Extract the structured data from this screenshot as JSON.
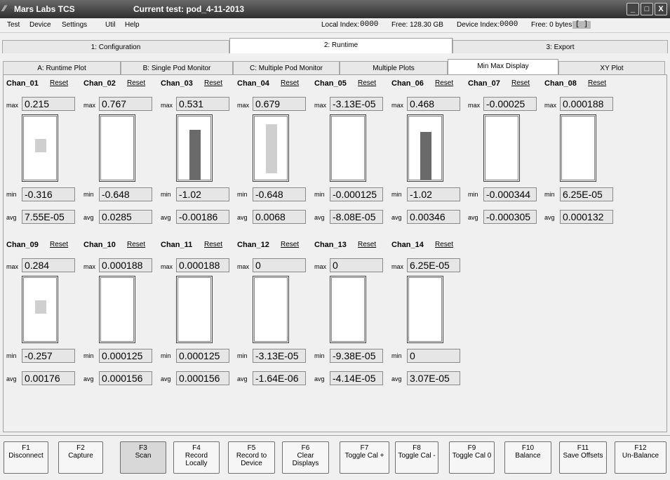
{
  "window": {
    "app_title": "Mars Labs TCS",
    "current_test": "Current test: pod_4-11-2013",
    "controls": [
      "_",
      "□",
      "X"
    ]
  },
  "menu": {
    "items": [
      "Test",
      "Device",
      "Settings",
      "Util",
      "Help"
    ]
  },
  "status": {
    "local_index_label": "Local Index:",
    "local_index_value": "0000",
    "local_free": "Free: 128.30 GB",
    "device_index_label": "Device Index:",
    "device_index_value": "0000",
    "device_free": "Free: 0 bytes",
    "indicator": "[ ]"
  },
  "main_tabs": [
    "1: Configuration",
    "2: Runtime",
    "3: Export"
  ],
  "sub_tabs": [
    "A: Runtime Plot",
    "B: Single Pod Monitor",
    "C: Multiple Pod Monitor",
    "Multiple Plots",
    "Min Max Display",
    "XY Plot"
  ],
  "labels": {
    "max": "max",
    "min": "min",
    "avg": "avg",
    "reset": "Reset"
  },
  "channels": [
    {
      "name": "Chan_01",
      "max": "0.215",
      "min": "-0.316",
      "avg": "7.55E-05",
      "bar": {
        "from": 0.42,
        "to": 0.63,
        "style": "light"
      }
    },
    {
      "name": "Chan_02",
      "max": "0.767",
      "min": "-0.648",
      "avg": "0.0285",
      "bar": null
    },
    {
      "name": "Chan_03",
      "max": "0.531",
      "min": "-1.02",
      "avg": "-0.00186",
      "bar": {
        "from": 0.0,
        "to": 0.77,
        "style": "dark"
      }
    },
    {
      "name": "Chan_04",
      "max": "0.679",
      "min": "-0.648",
      "avg": "0.0068",
      "bar": {
        "from": 0.1,
        "to": 0.86,
        "style": "light"
      }
    },
    {
      "name": "Chan_05",
      "max": "-3.13E-05",
      "min": "-0.000125",
      "avg": "-8.08E-05",
      "bar": null
    },
    {
      "name": "Chan_06",
      "max": "0.468",
      "min": "-1.02",
      "avg": "0.00346",
      "bar": {
        "from": 0.0,
        "to": 0.74,
        "style": "dark"
      }
    },
    {
      "name": "Chan_07",
      "max": "-0.00025",
      "min": "-0.000344",
      "avg": "-0.000305",
      "bar": null
    },
    {
      "name": "Chan_08",
      "max": "0.000188",
      "min": "6.25E-05",
      "avg": "0.000132",
      "bar": null
    },
    {
      "name": "Chan_09",
      "max": "0.284",
      "min": "-0.257",
      "avg": "0.00176",
      "bar": {
        "from": 0.42,
        "to": 0.63,
        "style": "light"
      }
    },
    {
      "name": "Chan_10",
      "max": "0.000188",
      "min": "0.000125",
      "avg": "0.000156",
      "bar": null
    },
    {
      "name": "Chan_11",
      "max": "0.000188",
      "min": "0.000125",
      "avg": "0.000156",
      "bar": null
    },
    {
      "name": "Chan_12",
      "max": "0",
      "min": "-3.13E-05",
      "avg": "-1.64E-06",
      "bar": null
    },
    {
      "name": "Chan_13",
      "max": "0",
      "min": "-9.38E-05",
      "avg": "-4.14E-05",
      "bar": null
    },
    {
      "name": "Chan_14",
      "max": "6.25E-05",
      "min": "0",
      "avg": "3.07E-05",
      "bar": null
    }
  ],
  "function_keys": [
    {
      "key": "F1",
      "label": "Disconnect",
      "pressed": false
    },
    {
      "key": "F2",
      "label": "Capture",
      "pressed": false
    },
    {
      "key": "F3",
      "label": "Scan",
      "pressed": true
    },
    {
      "key": "F4",
      "label": "Record\nLocally",
      "pressed": false
    },
    {
      "key": "F5",
      "label": "Record to\nDevice",
      "pressed": false
    },
    {
      "key": "F6",
      "label": "Clear\nDisplays",
      "pressed": false
    },
    {
      "key": "F7",
      "label": "Toggle Cal +",
      "pressed": false
    },
    {
      "key": "F8",
      "label": "Toggle Cal -",
      "pressed": false
    },
    {
      "key": "F9",
      "label": "Toggle Cal 0",
      "pressed": false
    },
    {
      "key": "F10",
      "label": "Balance",
      "pressed": false
    },
    {
      "key": "F11",
      "label": "Save Offsets",
      "pressed": false
    },
    {
      "key": "F12",
      "label": "Un-Balance",
      "pressed": false
    }
  ],
  "colors": {
    "title_bar": "#3a3a3a",
    "panel_bg": "#f0f0f0",
    "bar_light": "#cfcfcf",
    "bar_dark": "#6a6a6a"
  }
}
